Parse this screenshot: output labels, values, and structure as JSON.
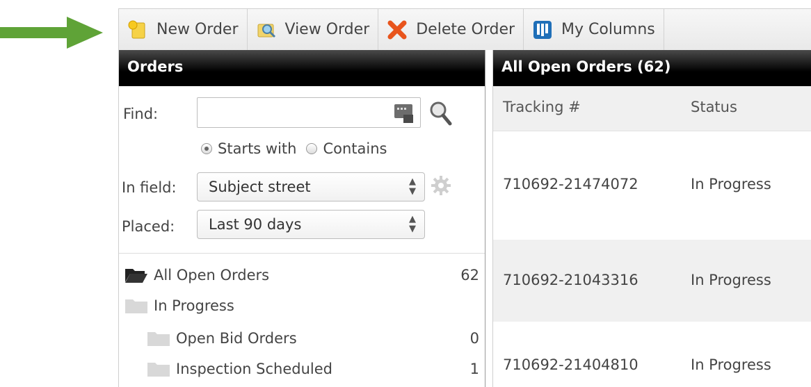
{
  "toolbar": {
    "new_order": "New Order",
    "view_order": "View Order",
    "delete_order": "Delete Order",
    "my_columns": "My Columns"
  },
  "orders_panel": {
    "title": "Orders",
    "find_label": "Find:",
    "find_value": "",
    "match_options": {
      "starts_with": "Starts with",
      "contains": "Contains",
      "selected": "starts_with"
    },
    "in_field_label": "In field:",
    "in_field_value": "Subject street",
    "placed_label": "Placed:",
    "placed_value": "Last 90 days",
    "tree": [
      {
        "label": "All Open Orders",
        "count": "62"
      },
      {
        "label": "In Progress",
        "count": ""
      },
      {
        "label": "Open Bid Orders",
        "count": "0"
      },
      {
        "label": "Inspection Scheduled",
        "count": "1"
      }
    ]
  },
  "list_panel": {
    "title": "All Open Orders (62)",
    "columns": [
      "Tracking #",
      "Status"
    ],
    "rows": [
      {
        "tracking": "710692-21474072",
        "status": "In Progress"
      },
      {
        "tracking": "710692-21043316",
        "status": "In Progress"
      },
      {
        "tracking": "710692-21404810",
        "status": "In Progress"
      }
    ]
  },
  "colors": {
    "arrow": "#5fa337",
    "header_bg": "#000000",
    "row_alt": "#f0f0f0",
    "delete_icon": "#e8541c",
    "columns_icon": "#1f6fb8"
  },
  "icons": [
    "arrow-icon",
    "new-order-icon",
    "view-order-icon",
    "delete-icon",
    "columns-icon",
    "keyboard-icon",
    "search-icon",
    "gear-icon",
    "folder-open-icon",
    "folder-icon"
  ]
}
